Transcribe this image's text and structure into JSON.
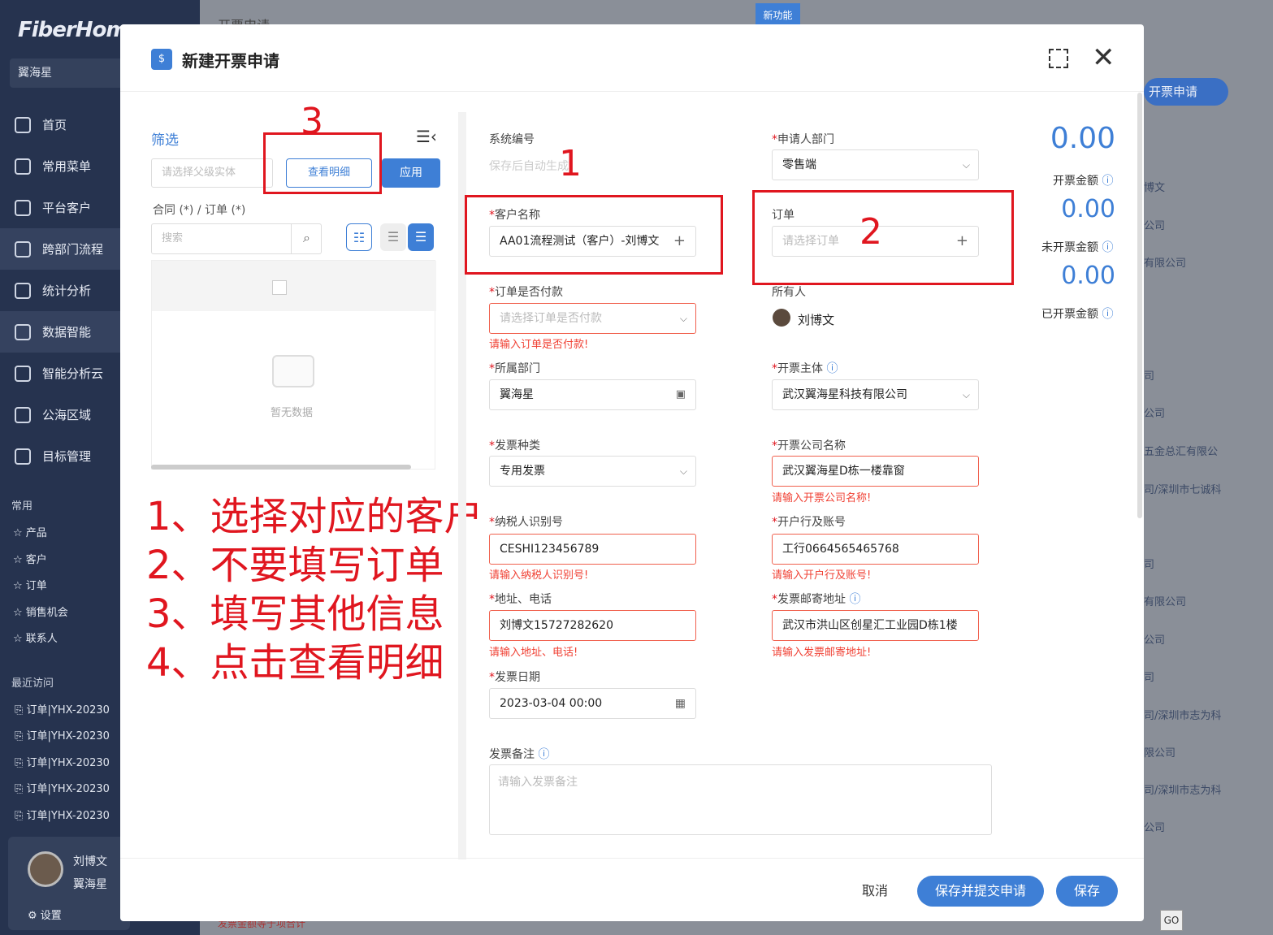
{
  "app": {
    "logo": "FiberHome",
    "org": "翼海星"
  },
  "sidebar": {
    "items": [
      {
        "label": "首页",
        "icon": "home-icon"
      },
      {
        "label": "常用菜单",
        "icon": "grid-icon"
      },
      {
        "label": "平台客户",
        "icon": "users-icon"
      },
      {
        "label": "跨部门流程",
        "icon": "flow-icon"
      },
      {
        "label": "统计分析",
        "icon": "pie-icon"
      },
      {
        "label": "数据智能",
        "icon": "data-icon"
      },
      {
        "label": "智能分析云",
        "icon": "chart-icon"
      },
      {
        "label": "公海区域",
        "icon": "tree-icon"
      },
      {
        "label": "目标管理",
        "icon": "target-icon"
      }
    ],
    "common_title": "常用",
    "favorites": [
      "☆ 产品",
      "☆ 客户",
      "☆ 订单",
      "☆ 销售机会",
      "☆ 联系人"
    ],
    "recent_title": "最近访问",
    "recent": [
      "订单|YHX-20230",
      "订单|YHX-20230",
      "订单|YHX-20230",
      "订单|YHX-20230",
      "订单|YHX-20230"
    ],
    "user": {
      "name": "刘博文",
      "org": "翼海星",
      "settings": "设置"
    }
  },
  "background": {
    "page_title": "开票申请",
    "new_feature": "新功能",
    "new_btn": "开票申请",
    "rows": [
      "博文",
      "公司",
      "有限公司",
      "司",
      "公司",
      "五金总汇有限公",
      "司/深圳市七诚科",
      "司",
      "有限公司",
      "公司",
      "司",
      "司/深圳市志为科",
      "限公司",
      "司/深圳市志为科",
      "公司"
    ],
    "pager_go": "GO",
    "bottom_text": "发票金额等于项合计"
  },
  "modal": {
    "icon_text": "$",
    "title": "新建开票申请",
    "filter": {
      "title": "筛选",
      "parent_placeholder": "请选择父级实体",
      "detail_btn": "查看明细",
      "apply_btn": "应用",
      "subtitle": "合同 (*) / 订单 (*)",
      "search_placeholder": "搜索",
      "empty_text": "暂无数据"
    },
    "notes": [
      "1、选择对应的客户",
      "2、不要填写订单",
      "3、填写其他信息",
      "4、点击查看明细"
    ],
    "form": {
      "sys_no_label": "系统编号",
      "sys_no_value": "保存后自动生成",
      "dept_label": "申请人部门",
      "dept_value": "零售端",
      "customer_label": "客户名称",
      "customer_value": "AA01流程测试（客户）-刘博文",
      "order_label": "订单",
      "order_placeholder": "请选择订单",
      "paid_label": "订单是否付款",
      "paid_placeholder": "请选择订单是否付款",
      "paid_error": "请输入订单是否付款!",
      "owner_label": "所有人",
      "owner_value": "刘博文",
      "belong_dept_label": "所属部门",
      "belong_dept_value": "翼海星",
      "subject_label": "开票主体",
      "subject_value": "武汉翼海星科技有限公司",
      "invoice_type_label": "发票种类",
      "invoice_type_value": "专用发票",
      "company_label": "开票公司名称",
      "company_value": "武汉翼海星D栋一楼靠窗",
      "company_error": "请输入开票公司名称!",
      "tax_label": "纳税人识别号",
      "tax_value": "CESHI123456789",
      "tax_error": "请输入纳税人识别号!",
      "bank_label": "开户行及账号",
      "bank_value": "工行0664565465768",
      "bank_error": "请输入开户行及账号!",
      "addr_label": "地址、电话",
      "addr_value": "刘博文15727282620",
      "addr_error": "请输入地址、电话!",
      "mail_label": "发票邮寄地址",
      "mail_value": "武汉市洪山区创星汇工业园D栋1楼",
      "mail_error": "请输入发票邮寄地址!",
      "date_label": "发票日期",
      "date_value": "2023-03-04 00:00",
      "remark_label": "发票备注",
      "remark_placeholder": "请输入发票备注"
    },
    "amounts": {
      "invoiced": "0.00",
      "invoiced_label": "开票金额",
      "uninvoiced": "0.00",
      "uninvoiced_label": "未开票金额",
      "done": "0.00",
      "done_label": "已开票金额"
    },
    "footer": {
      "cancel": "取消",
      "submit": "保存并提交申请",
      "save": "保存"
    },
    "annotations": [
      "1",
      "2",
      "3"
    ]
  }
}
